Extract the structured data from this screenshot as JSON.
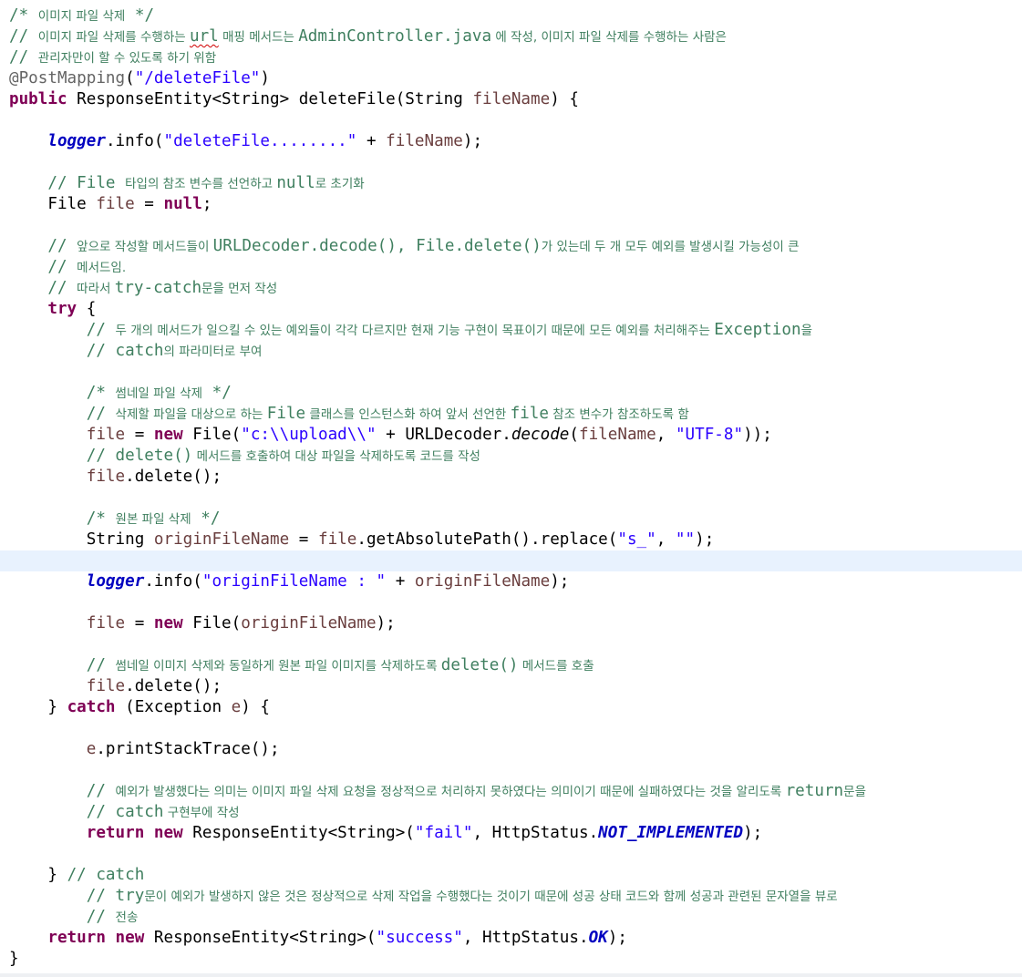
{
  "editor": {
    "language": "java",
    "current_line": 26,
    "lines": [
      {
        "indent": "",
        "parts": [
          [
            "c",
            "/* "
          ],
          [
            "c ko",
            "이미지 파일 삭제"
          ],
          [
            "c",
            " */"
          ]
        ]
      },
      {
        "indent": "",
        "parts": [
          [
            "c",
            "// "
          ],
          [
            "c ko",
            "이미지 파일 삭제를 수행하는 "
          ],
          [
            "c sq",
            "url"
          ],
          [
            "c ko",
            " 매핑 메서드는 "
          ],
          [
            "c",
            "AdminController.java"
          ],
          [
            "c ko",
            " 에 작성, "
          ],
          [
            "c ko",
            "이미지 파일 삭제를 수행하는 사람은"
          ]
        ]
      },
      {
        "indent": "",
        "parts": [
          [
            "c",
            "// "
          ],
          [
            "c ko",
            "관리자만이 할 수 있도록 하기 위함"
          ]
        ]
      },
      {
        "indent": "",
        "parts": [
          [
            "an",
            "@PostMapping"
          ],
          [
            "",
            "("
          ],
          [
            "s",
            "\"/deleteFile\""
          ],
          [
            "",
            ")"
          ]
        ]
      },
      {
        "indent": "",
        "parts": [
          [
            "k",
            "public"
          ],
          [
            "",
            " ResponseEntity<String> deleteFile(String "
          ],
          [
            "v",
            "fileName"
          ],
          [
            "",
            ") {"
          ]
        ]
      },
      {
        "indent": "",
        "parts": []
      },
      {
        "indent": "    ",
        "parts": [
          [
            "f",
            "logger"
          ],
          [
            "",
            ".info("
          ],
          [
            "s",
            "\"deleteFile........\""
          ],
          [
            "",
            " + "
          ],
          [
            "v",
            "fileName"
          ],
          [
            "",
            ");"
          ]
        ]
      },
      {
        "indent": "",
        "parts": []
      },
      {
        "indent": "    ",
        "parts": [
          [
            "c",
            "// File "
          ],
          [
            "c ko",
            "타입의 참조 변수를 선언하고 "
          ],
          [
            "c",
            "null"
          ],
          [
            "c ko",
            "로 초기화"
          ]
        ]
      },
      {
        "indent": "    ",
        "parts": [
          [
            "",
            "File "
          ],
          [
            "v",
            "file"
          ],
          [
            "",
            " = "
          ],
          [
            "k",
            "null"
          ],
          [
            "",
            ";"
          ]
        ]
      },
      {
        "indent": "",
        "parts": []
      },
      {
        "indent": "    ",
        "parts": [
          [
            "c",
            "// "
          ],
          [
            "c ko",
            "앞으로 작성할 메서드들이 "
          ],
          [
            "c",
            "URLDecoder.decode(), File.delete()"
          ],
          [
            "c ko",
            "가 있는데 두 개 모두 예외를 발생시킬 가능성이 큰"
          ]
        ]
      },
      {
        "indent": "    ",
        "parts": [
          [
            "c",
            "// "
          ],
          [
            "c ko",
            "메서드임."
          ]
        ]
      },
      {
        "indent": "    ",
        "parts": [
          [
            "c",
            "// "
          ],
          [
            "c ko",
            "따라서 "
          ],
          [
            "c",
            "try-catch"
          ],
          [
            "c ko",
            "문을 먼저 작성"
          ]
        ]
      },
      {
        "indent": "    ",
        "parts": [
          [
            "k",
            "try"
          ],
          [
            "",
            " {"
          ]
        ]
      },
      {
        "indent": "        ",
        "parts": [
          [
            "c",
            "// "
          ],
          [
            "c ko",
            "두 개의 메서드가 일으킬 수 있는 예외들이 각각 다르지만 현재 기능 구현이 목표이기 때문에 모든 예외를 처리해주는 "
          ],
          [
            "c",
            "Exception"
          ],
          [
            "c ko",
            "을"
          ]
        ]
      },
      {
        "indent": "        ",
        "parts": [
          [
            "c",
            "// catch"
          ],
          [
            "c ko",
            "의 파라미터로 부여"
          ]
        ]
      },
      {
        "indent": "",
        "parts": []
      },
      {
        "indent": "        ",
        "parts": [
          [
            "c",
            "/* "
          ],
          [
            "c ko",
            "썸네일 파일 삭제"
          ],
          [
            "c",
            " */"
          ]
        ]
      },
      {
        "indent": "        ",
        "parts": [
          [
            "c",
            "// "
          ],
          [
            "c ko",
            "삭제할 파일을 대상으로 하는 "
          ],
          [
            "c",
            "File"
          ],
          [
            "c ko",
            " 클래스를 인스턴스화 하여 앞서 선언한 "
          ],
          [
            "c",
            "file"
          ],
          [
            "c ko",
            " 참조 변수가 참조하도록 함"
          ]
        ]
      },
      {
        "indent": "        ",
        "parts": [
          [
            "v",
            "file"
          ],
          [
            "",
            " = "
          ],
          [
            "k",
            "new"
          ],
          [
            "",
            " File("
          ],
          [
            "s",
            "\"c:\\\\upload\\\\\""
          ],
          [
            "",
            " + URLDecoder."
          ],
          [
            "it",
            "decode"
          ],
          [
            "",
            "("
          ],
          [
            "v",
            "fileName"
          ],
          [
            "",
            ", "
          ],
          [
            "s",
            "\"UTF-8\""
          ],
          [
            "",
            "));"
          ]
        ]
      },
      {
        "indent": "        ",
        "parts": [
          [
            "c",
            "// delete()"
          ],
          [
            "c ko",
            " 메서드를 호출하여 대상 파일을 삭제하도록 코드를 작성"
          ]
        ]
      },
      {
        "indent": "        ",
        "parts": [
          [
            "v",
            "file"
          ],
          [
            "",
            ".delete();"
          ]
        ]
      },
      {
        "indent": "",
        "parts": []
      },
      {
        "indent": "        ",
        "parts": [
          [
            "c",
            "/* "
          ],
          [
            "c ko",
            "원본 파일 삭제"
          ],
          [
            "c",
            " */"
          ]
        ]
      },
      {
        "indent": "        ",
        "parts": [
          [
            "",
            "String "
          ],
          [
            "v",
            "originFileName"
          ],
          [
            "",
            " = "
          ],
          [
            "v",
            "file"
          ],
          [
            "",
            ".getAbsolutePath().replace("
          ],
          [
            "s",
            "\"s_\""
          ],
          [
            "",
            ", "
          ],
          [
            "s",
            "\"\""
          ],
          [
            "",
            ");"
          ]
        ]
      },
      {
        "indent": "",
        "parts": []
      },
      {
        "indent": "        ",
        "parts": [
          [
            "f",
            "logger"
          ],
          [
            "",
            ".info("
          ],
          [
            "s",
            "\"originFileName : \""
          ],
          [
            "",
            " + "
          ],
          [
            "v",
            "originFileName"
          ],
          [
            "",
            ");"
          ]
        ]
      },
      {
        "indent": "",
        "parts": []
      },
      {
        "indent": "        ",
        "parts": [
          [
            "v",
            "file"
          ],
          [
            "",
            " = "
          ],
          [
            "k",
            "new"
          ],
          [
            "",
            " File("
          ],
          [
            "v",
            "originFileName"
          ],
          [
            "",
            ");"
          ]
        ]
      },
      {
        "indent": "",
        "parts": []
      },
      {
        "indent": "        ",
        "parts": [
          [
            "c",
            "// "
          ],
          [
            "c ko",
            "썸네일 이미지 삭제와 동일하게 원본 파일 이미지를 삭제하도록 "
          ],
          [
            "c",
            "delete()"
          ],
          [
            "c ko",
            " 메서드를 호출"
          ]
        ]
      },
      {
        "indent": "        ",
        "parts": [
          [
            "v",
            "file"
          ],
          [
            "",
            ".delete();"
          ]
        ]
      },
      {
        "indent": "    ",
        "parts": [
          [
            "",
            "} "
          ],
          [
            "k",
            "catch"
          ],
          [
            "",
            " (Exception "
          ],
          [
            "v",
            "e"
          ],
          [
            "",
            ") {"
          ]
        ]
      },
      {
        "indent": "",
        "parts": []
      },
      {
        "indent": "        ",
        "parts": [
          [
            "v",
            "e"
          ],
          [
            "",
            ".printStackTrace();"
          ]
        ]
      },
      {
        "indent": "",
        "parts": []
      },
      {
        "indent": "        ",
        "parts": [
          [
            "c",
            "// "
          ],
          [
            "c ko",
            "예외가 발생했다는 의미는 이미지 파일 삭제 요청을 정상적으로 처리하지 못하였다는 의미이기 때문에 실패하였다는 것을 알리도록 "
          ],
          [
            "c",
            "return"
          ],
          [
            "c ko",
            "문을"
          ]
        ]
      },
      {
        "indent": "        ",
        "parts": [
          [
            "c",
            "// catch"
          ],
          [
            "c ko",
            " 구현부에 작성"
          ]
        ]
      },
      {
        "indent": "        ",
        "parts": [
          [
            "k",
            "return"
          ],
          [
            "",
            ""
          ],
          [
            "k",
            " new"
          ],
          [
            "",
            " ResponseEntity<String>("
          ],
          [
            "s",
            "\"fail\""
          ],
          [
            "",
            ", HttpStatus."
          ],
          [
            "f",
            "NOT_IMPLEMENTED"
          ],
          [
            "",
            ");"
          ]
        ]
      },
      {
        "indent": "",
        "parts": []
      },
      {
        "indent": "    ",
        "parts": [
          [
            "",
            "} "
          ],
          [
            "c",
            "// catch"
          ]
        ]
      },
      {
        "indent": "        ",
        "parts": [
          [
            "c",
            "// try"
          ],
          [
            "c ko",
            "문이 예외가 발생하지 않은 것은 정상적으로 삭제 작업을 수행했다는 것이기 때문에 성공 상태 코드와 함께 성공과 관련된 문자열을 뷰로"
          ]
        ]
      },
      {
        "indent": "        ",
        "parts": [
          [
            "c",
            "// "
          ],
          [
            "c ko",
            "전송"
          ]
        ]
      },
      {
        "indent": "    ",
        "parts": [
          [
            "k",
            "return"
          ],
          [
            "k",
            " new"
          ],
          [
            "",
            " ResponseEntity<String>("
          ],
          [
            "s",
            "\"success\""
          ],
          [
            "",
            ", HttpStatus."
          ],
          [
            "f",
            "OK"
          ],
          [
            "",
            ");"
          ]
        ]
      },
      {
        "indent": "",
        "parts": [
          [
            "",
            "}"
          ]
        ]
      }
    ]
  }
}
